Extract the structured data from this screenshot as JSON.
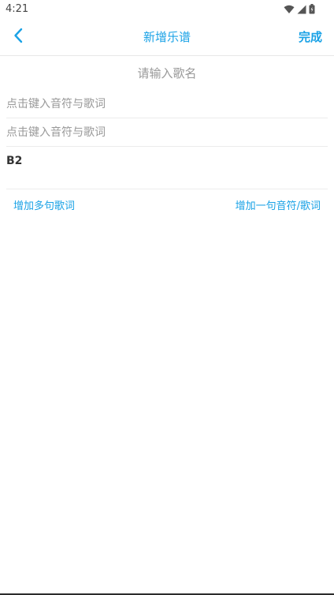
{
  "status_bar": {
    "time": "4:21",
    "icons": [
      "wifi-icon",
      "cell-signal-icon",
      "battery-icon"
    ]
  },
  "header": {
    "title": "新增乐谱",
    "done_label": "完成",
    "back_icon": "chevron-left-icon"
  },
  "form": {
    "song_name_placeholder": "请输入歌名",
    "rows": [
      {
        "placeholder": "点击键入音符与歌词"
      },
      {
        "placeholder": "点击键入音符与歌词"
      }
    ],
    "note_line": "B2"
  },
  "actions": {
    "add_multi_lyrics": "增加多句歌词",
    "add_note_lyric": "增加一句音符/歌词"
  },
  "colors": {
    "accent": "#1aa2e6",
    "placeholder": "#999999",
    "divider": "#ececec"
  }
}
